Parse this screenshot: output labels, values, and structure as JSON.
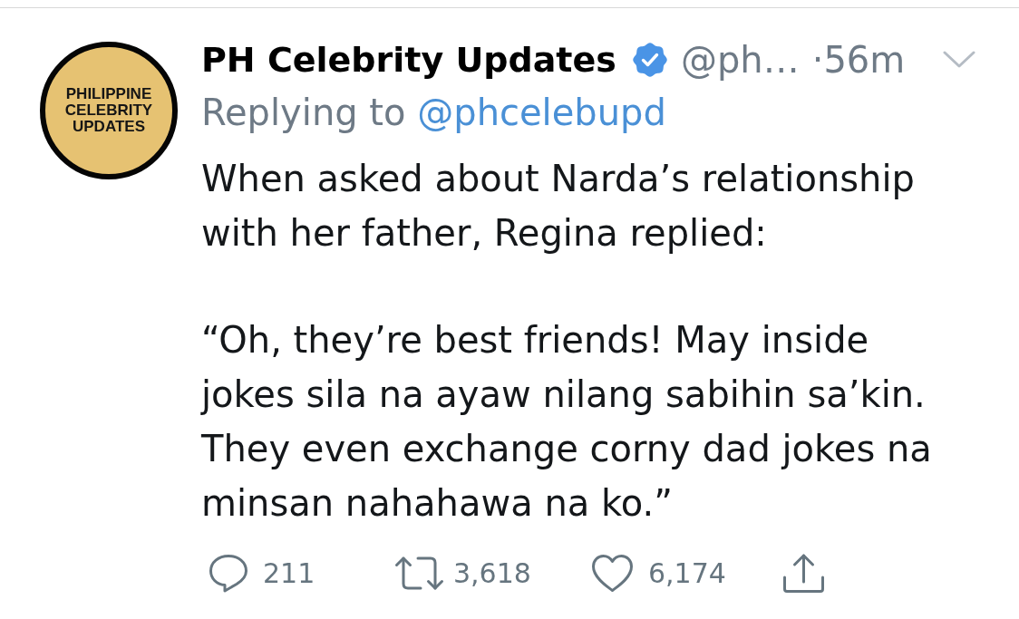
{
  "tweet": {
    "avatar": {
      "lines": [
        "PHILIPPINE",
        "CELEBRITY",
        "UPDATES"
      ]
    },
    "author": {
      "name": "PH Celebrity Updates",
      "verified": true,
      "handle": "@ph…"
    },
    "separator": "·",
    "time": "56m",
    "reply_context": {
      "label": "Replying to",
      "mention": "@phcelebupd"
    },
    "body": {
      "paragraphs": [
        [
          "When asked about Narda’s relationship",
          "with her father, Regina replied:"
        ],
        [
          "“Oh, they’re best friends! May inside",
          "jokes sila na ayaw nilang sabihin sa’kin.",
          "They even exchange corny dad jokes na",
          "minsan nahahawa na ko.”"
        ]
      ]
    },
    "actions": [
      {
        "kind": "reply",
        "count": "211"
      },
      {
        "kind": "retweet",
        "count": "3,618"
      },
      {
        "kind": "like",
        "count": "6,174"
      },
      {
        "kind": "share"
      }
    ]
  }
}
